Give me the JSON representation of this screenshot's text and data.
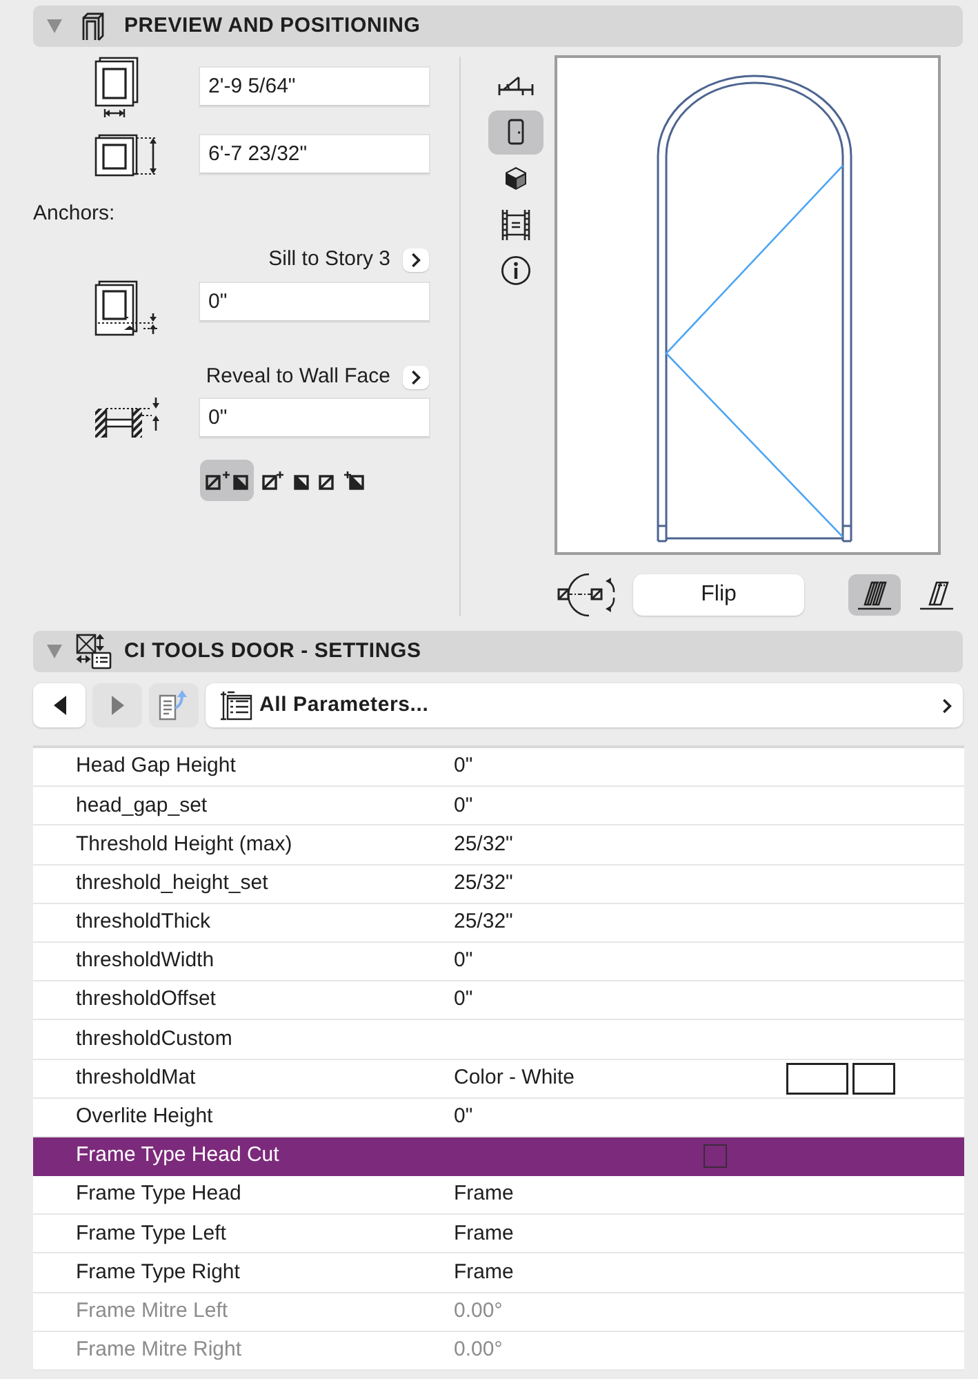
{
  "preview_section": {
    "title": "PREVIEW AND POSITIONING",
    "expanded": true,
    "width_value": "2'-9 5/64\"",
    "height_value": "6'-7 23/32\"",
    "anchors_label": "Anchors:",
    "sill": {
      "label": "Sill to Story 3",
      "value": "0\""
    },
    "reveal": {
      "label": "Reveal to Wall Face",
      "value": "0\""
    },
    "anchor_options": [
      {
        "kind": "both",
        "selected": true
      },
      {
        "kind": "outer",
        "selected": false
      },
      {
        "kind": "left",
        "selected": false
      },
      {
        "kind": "right",
        "selected": false
      },
      {
        "kind": "inner",
        "selected": false
      }
    ],
    "view_modes": [
      {
        "kind": "plan",
        "selected": false
      },
      {
        "kind": "door",
        "selected": true
      },
      {
        "kind": "solid",
        "selected": false
      },
      {
        "kind": "section",
        "selected": false
      },
      {
        "kind": "info",
        "selected": false
      }
    ],
    "flip_button": "Flip",
    "opening_modes": [
      {
        "kind": "full",
        "selected": true
      },
      {
        "kind": "half",
        "selected": false
      }
    ]
  },
  "settings_section": {
    "title": "CI TOOLS DOOR - SETTINGS",
    "expanded": true,
    "nav_buttons": [
      {
        "kind": "back",
        "disabled": false
      },
      {
        "kind": "forward",
        "disabled": true
      },
      {
        "kind": "export",
        "disabled": true
      }
    ],
    "page_menu": "All Parameters...",
    "rows": [
      {
        "name": "Head Gap Height",
        "value": "0\"",
        "kind": "text",
        "selected": false,
        "disabled": false
      },
      {
        "name": "head_gap_set",
        "value": "0\"",
        "kind": "text",
        "selected": false,
        "disabled": false
      },
      {
        "name": "Threshold Height (max)",
        "value": "25/32\"",
        "kind": "text",
        "selected": false,
        "disabled": false
      },
      {
        "name": "threshold_height_set",
        "value": "25/32\"",
        "kind": "text",
        "selected": false,
        "disabled": false
      },
      {
        "name": "thresholdThick",
        "value": "25/32\"",
        "kind": "text",
        "selected": false,
        "disabled": false
      },
      {
        "name": "thresholdWidth",
        "value": "0\"",
        "kind": "text",
        "selected": false,
        "disabled": false
      },
      {
        "name": "thresholdOffset",
        "value": "0\"",
        "kind": "text",
        "selected": false,
        "disabled": false
      },
      {
        "name": "thresholdCustom",
        "kind": "text",
        "selected": false,
        "disabled": false
      },
      {
        "name": "thresholdMat",
        "value": "Color - White",
        "kind": "material",
        "selected": false,
        "disabled": false
      },
      {
        "name": "Overlite Height",
        "value": "0\"",
        "kind": "text",
        "selected": false,
        "disabled": false
      },
      {
        "name": "Frame Type Head Cut",
        "kind": "checkbox",
        "checked": false,
        "selected": true,
        "disabled": false
      },
      {
        "name": "Frame Type Head",
        "value": "Frame",
        "kind": "text",
        "selected": false,
        "disabled": false
      },
      {
        "name": "Frame Type Left",
        "value": "Frame",
        "kind": "text",
        "selected": false,
        "disabled": false
      },
      {
        "name": "Frame Type Right",
        "value": "Frame",
        "kind": "text",
        "selected": false,
        "disabled": false
      },
      {
        "name": "Frame Mitre Left",
        "value": "0.00°",
        "kind": "text",
        "selected": false,
        "disabled": true
      },
      {
        "name": "Frame Mitre Right",
        "value": "0.00°",
        "kind": "text",
        "selected": false,
        "disabled": true
      }
    ]
  }
}
